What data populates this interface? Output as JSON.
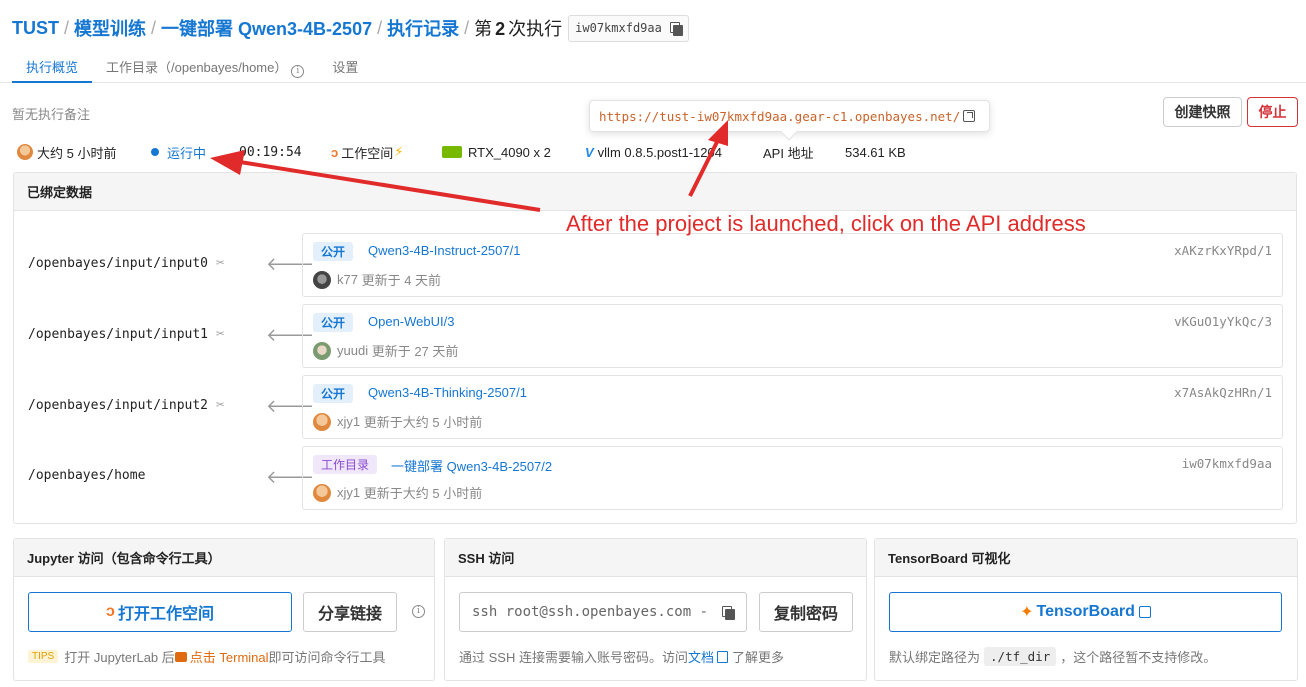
{
  "breadcrumb": {
    "org": "TUST",
    "section": "模型训练",
    "project": "一键部署 Qwen3-4B-2507",
    "records": "执行记录",
    "current_prefix": "第",
    "current_num": "2",
    "current_suffix": "次执行",
    "run_id": "iw07kmxfd9aa"
  },
  "tabs": [
    {
      "label": "执行概览",
      "active": true
    },
    {
      "label": "工作目录（/openbayes/home）",
      "active": false
    },
    {
      "label": "设置",
      "active": false
    }
  ],
  "note": "暂无执行备注",
  "api_url": "https://tust-iw07kmxfd9aa.gear-c1.openbayes.net/",
  "buttons": {
    "snapshot": "创建快照",
    "stop": "停止"
  },
  "status": {
    "started": "大约 5 小时前",
    "state": "运行中",
    "duration": "00:19:54",
    "workspace": "工作空间",
    "gpu": "RTX_4090 x 2",
    "image": "vllm 0.8.5.post1-1204",
    "api_label": "API 地址",
    "size": "534.61 KB"
  },
  "bound_data": {
    "title": "已绑定数据",
    "rows": [
      {
        "path": "/openbayes/input/input0",
        "badge": "公开",
        "name": "Qwen3-4B-Instruct-2507/1",
        "id": "xAKzrKxYRpd/1",
        "user": "k77",
        "updated": "更新于 4 天前"
      },
      {
        "path": "/openbayes/input/input1",
        "badge": "公开",
        "name": "Open-WebUI/3",
        "id": "vKGuO1yYkQc/3",
        "user": "yuudi",
        "updated": "更新于 27 天前"
      },
      {
        "path": "/openbayes/input/input2",
        "badge": "公开",
        "name": "Qwen3-4B-Thinking-2507/1",
        "id": "x7AsAkQzHRn/1",
        "user": "xjy1",
        "updated": "更新于大约 5 小时前"
      },
      {
        "path": "/openbayes/home",
        "badge": "工作目录",
        "name": "一键部署 Qwen3-4B-2507/2",
        "id": "iw07kmxfd9aa",
        "user": "xjy1",
        "updated": "更新于大约 5 小时前"
      }
    ]
  },
  "jupyter": {
    "title": "Jupyter 访问（包含命令行工具）",
    "open_btn": "打开工作空间",
    "share_btn": "分享链接",
    "tips": "TIPS",
    "foot_a": "打开 JupyterLab 后",
    "foot_b": "点击 Terminal",
    "foot_c": "即可访问命令行工具"
  },
  "ssh": {
    "title": "SSH 访问",
    "command": "ssh root@ssh.openbayes.com -",
    "copy_pwd": "复制密码",
    "foot_a": "通过 SSH 连接需要输入账号密码。访问",
    "foot_link": "文档",
    "foot_b": "了解更多"
  },
  "tensorboard": {
    "title": "TensorBoard 可视化",
    "btn": "TensorBoard",
    "foot_a": "默认绑定路径为",
    "foot_code": "./tf_dir",
    "foot_b": "，这个路径暂不支持修改。"
  },
  "annotation": "After the project is launched, click on the API address"
}
